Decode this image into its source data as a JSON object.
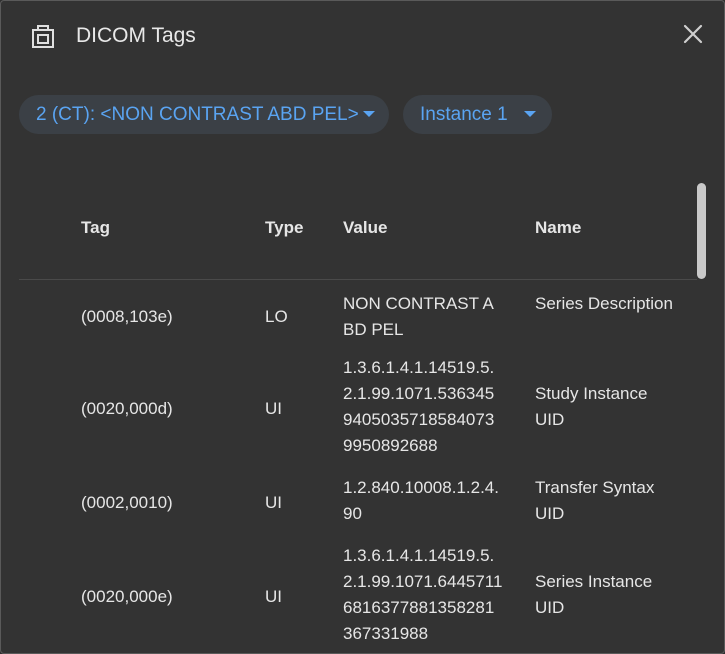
{
  "dialog": {
    "title": "DICOM Tags",
    "header_icon": "tag-browser-icon",
    "close_icon": "close-icon"
  },
  "selectors": {
    "series": "2 (CT): <NON CONTRAST ABD PEL>",
    "instance": "Instance 1"
  },
  "table": {
    "columns": [
      "Tag",
      "Type",
      "Value",
      "Name"
    ],
    "rows": [
      {
        "tag": "(0008,103e)",
        "type": "LO",
        "value": "NON CONTRAST ABD PEL",
        "name": "Series Description"
      },
      {
        "tag": "(0020,000d)",
        "type": "UI",
        "value": "1.3.6.1.4.1.14519.5.2.1.99.1071.53634594050357185840739950892688",
        "name": "Study Instance UID"
      },
      {
        "tag": "(0002,0010)",
        "type": "UI",
        "value": "1.2.840.10008.1.2.4.90",
        "name": "Transfer Syntax UID"
      },
      {
        "tag": "(0020,000e)",
        "type": "UI",
        "value": "1.3.6.1.4.1.14519.5.2.1.99.1071.64457116816377881358281367331988",
        "name": "Series Instance UID"
      }
    ]
  },
  "colors": {
    "background": "#333333",
    "accent": "#5aa4f2",
    "chip_bg": "#3b4046",
    "text": "#e6e6e6"
  }
}
